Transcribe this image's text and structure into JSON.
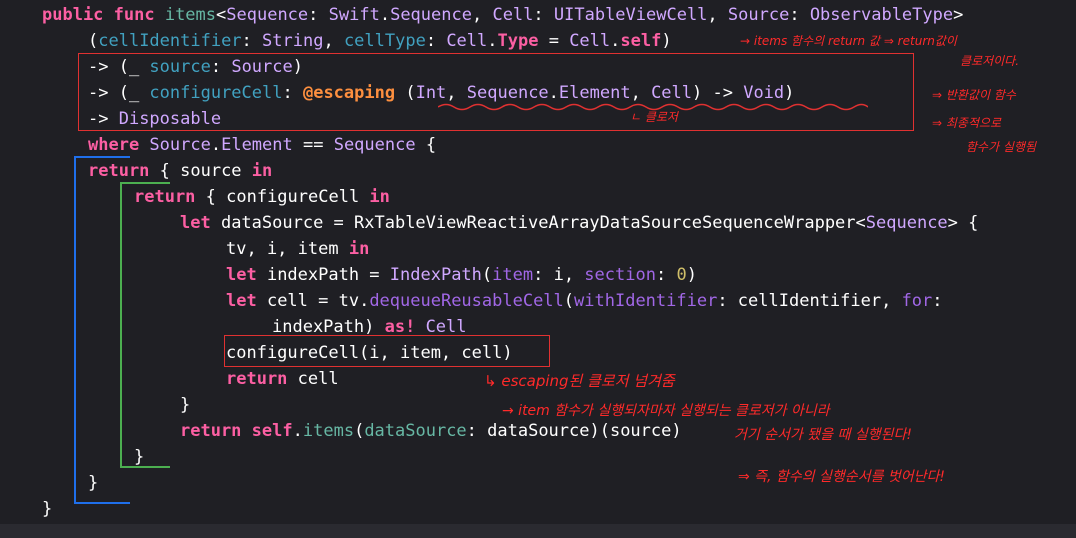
{
  "code": {
    "l1": {
      "a": "public func ",
      "b": "items",
      "c": "<",
      "d": "Sequence",
      "e": ": ",
      "f": "Swift",
      "g": ".",
      "h": "Sequence",
      "i": ", ",
      "j": "Cell",
      "k": ": ",
      "l": "UITableViewCell",
      "m": ", ",
      "n": "Source",
      "o": ": ",
      "p": "ObservableType",
      "q": ">"
    },
    "l2": {
      "a": "(",
      "b": "cellIdentifier",
      "c": ": ",
      "d": "String",
      "e": ", ",
      "f": "cellType",
      "g": ": ",
      "h": "Cell",
      "i": ".",
      "j": "Type",
      "k": " = ",
      "l": "Cell",
      "m": ".",
      "n": "self",
      "o": ")"
    },
    "l3": {
      "a": "-> (_ ",
      "b": "source",
      "c": ": ",
      "d": "Source",
      "e": ")"
    },
    "l4": {
      "a": "-> (_ ",
      "b": "configureCell",
      "c": ": ",
      "d": "@escaping",
      "e": " (",
      "f": "Int",
      "g": ", ",
      "h": "Sequence",
      "i": ".",
      "j": "Element",
      "k": ", ",
      "l": "Cell",
      "m": ") -> ",
      "n": "Void",
      "o": ")"
    },
    "l5": {
      "a": "-> ",
      "b": "Disposable"
    },
    "l6": {
      "a": "where ",
      "b": "Source",
      "c": ".",
      "d": "Element",
      "e": " == ",
      "f": "Sequence",
      "g": " {"
    },
    "l7": {
      "a": "return",
      "b": " { source ",
      "c": "in"
    },
    "l8": {
      "a": "return",
      "b": " { configureCell ",
      "c": "in"
    },
    "l9": {
      "a": "let",
      "b": " dataSource = ",
      "c": "RxTableViewReactiveArrayDataSourceSequenceWrapper",
      "d": "<",
      "e": "Sequence",
      "f": "> {"
    },
    "l10": {
      "a": "tv, i, item ",
      "b": "in"
    },
    "l11": {
      "a": "let",
      "b": " indexPath = ",
      "c": "IndexPath",
      "d": "(",
      "e": "item",
      "f": ": i, ",
      "g": "section",
      "h": ": ",
      "i": "0",
      "j": ")"
    },
    "l12": {
      "a": "let",
      "b": " cell = tv.",
      "c": "dequeueReusableCell",
      "d": "(",
      "e": "withIdentifier",
      "f": ": cellIdentifier, ",
      "g": "for",
      "h": ":"
    },
    "l13": {
      "a": "indexPath) ",
      "b": "as!",
      "c": " ",
      "d": "Cell"
    },
    "l14": {
      "a": "configureCell(i, item, cell)"
    },
    "l15": {
      "a": "return",
      "b": " cell"
    },
    "l16": {
      "a": "}"
    },
    "l17": {
      "a": "return",
      "b": " ",
      "c": "self",
      "d": ".",
      "e": "items",
      "f": "(",
      "g": "dataSource",
      "h": ": dataSource)(source)"
    },
    "l18": {
      "a": "}"
    },
    "l19": {
      "a": "}"
    },
    "l20": {
      "a": "}"
    }
  },
  "notes": {
    "n1": "→ items 함수의 return 값 ⇒ return값이",
    "n2": "클로저이다.",
    "n3": "⇒ 반환값이 함수",
    "n4": "⇒ 최종적으로",
    "n5": "함수가 실행됨",
    "n6": "ㄴ 클로저",
    "n7": "↳ escaping된 클로저 넘겨줌",
    "n8": "→ item 함수가 실행되자마자 실행되는 클로저가 아니라",
    "n9": "거기 순서가 됐을 때 실행된다!",
    "n10": "⇒ 즉, 함수의 실행순서를 벗어난다!"
  },
  "colors": {
    "keyword": "#fc5fa3",
    "type": "#d0a8ff",
    "function": "#67b7a4",
    "param": "#41a1c0",
    "number": "#d0bf69",
    "attribute": "#fd8f3f",
    "annotation_red": "#e03131",
    "bracket_blue": "#1f6feb",
    "bracket_green": "#4caf50"
  }
}
